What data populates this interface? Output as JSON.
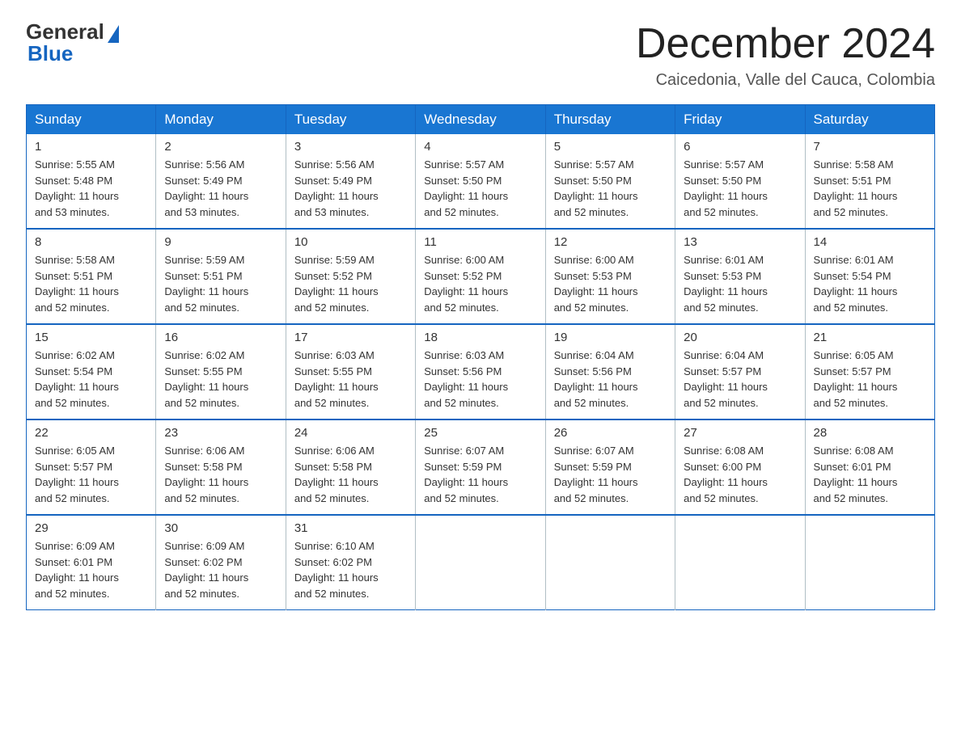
{
  "logo": {
    "general_text": "General",
    "blue_text": "Blue"
  },
  "header": {
    "month_year": "December 2024",
    "location": "Caicedonia, Valle del Cauca, Colombia"
  },
  "weekdays": [
    "Sunday",
    "Monday",
    "Tuesday",
    "Wednesday",
    "Thursday",
    "Friday",
    "Saturday"
  ],
  "weeks": [
    [
      {
        "day": "1",
        "sunrise": "5:55 AM",
        "sunset": "5:48 PM",
        "daylight": "11 hours and 53 minutes."
      },
      {
        "day": "2",
        "sunrise": "5:56 AM",
        "sunset": "5:49 PM",
        "daylight": "11 hours and 53 minutes."
      },
      {
        "day": "3",
        "sunrise": "5:56 AM",
        "sunset": "5:49 PM",
        "daylight": "11 hours and 53 minutes."
      },
      {
        "day": "4",
        "sunrise": "5:57 AM",
        "sunset": "5:50 PM",
        "daylight": "11 hours and 52 minutes."
      },
      {
        "day": "5",
        "sunrise": "5:57 AM",
        "sunset": "5:50 PM",
        "daylight": "11 hours and 52 minutes."
      },
      {
        "day": "6",
        "sunrise": "5:57 AM",
        "sunset": "5:50 PM",
        "daylight": "11 hours and 52 minutes."
      },
      {
        "day": "7",
        "sunrise": "5:58 AM",
        "sunset": "5:51 PM",
        "daylight": "11 hours and 52 minutes."
      }
    ],
    [
      {
        "day": "8",
        "sunrise": "5:58 AM",
        "sunset": "5:51 PM",
        "daylight": "11 hours and 52 minutes."
      },
      {
        "day": "9",
        "sunrise": "5:59 AM",
        "sunset": "5:51 PM",
        "daylight": "11 hours and 52 minutes."
      },
      {
        "day": "10",
        "sunrise": "5:59 AM",
        "sunset": "5:52 PM",
        "daylight": "11 hours and 52 minutes."
      },
      {
        "day": "11",
        "sunrise": "6:00 AM",
        "sunset": "5:52 PM",
        "daylight": "11 hours and 52 minutes."
      },
      {
        "day": "12",
        "sunrise": "6:00 AM",
        "sunset": "5:53 PM",
        "daylight": "11 hours and 52 minutes."
      },
      {
        "day": "13",
        "sunrise": "6:01 AM",
        "sunset": "5:53 PM",
        "daylight": "11 hours and 52 minutes."
      },
      {
        "day": "14",
        "sunrise": "6:01 AM",
        "sunset": "5:54 PM",
        "daylight": "11 hours and 52 minutes."
      }
    ],
    [
      {
        "day": "15",
        "sunrise": "6:02 AM",
        "sunset": "5:54 PM",
        "daylight": "11 hours and 52 minutes."
      },
      {
        "day": "16",
        "sunrise": "6:02 AM",
        "sunset": "5:55 PM",
        "daylight": "11 hours and 52 minutes."
      },
      {
        "day": "17",
        "sunrise": "6:03 AM",
        "sunset": "5:55 PM",
        "daylight": "11 hours and 52 minutes."
      },
      {
        "day": "18",
        "sunrise": "6:03 AM",
        "sunset": "5:56 PM",
        "daylight": "11 hours and 52 minutes."
      },
      {
        "day": "19",
        "sunrise": "6:04 AM",
        "sunset": "5:56 PM",
        "daylight": "11 hours and 52 minutes."
      },
      {
        "day": "20",
        "sunrise": "6:04 AM",
        "sunset": "5:57 PM",
        "daylight": "11 hours and 52 minutes."
      },
      {
        "day": "21",
        "sunrise": "6:05 AM",
        "sunset": "5:57 PM",
        "daylight": "11 hours and 52 minutes."
      }
    ],
    [
      {
        "day": "22",
        "sunrise": "6:05 AM",
        "sunset": "5:57 PM",
        "daylight": "11 hours and 52 minutes."
      },
      {
        "day": "23",
        "sunrise": "6:06 AM",
        "sunset": "5:58 PM",
        "daylight": "11 hours and 52 minutes."
      },
      {
        "day": "24",
        "sunrise": "6:06 AM",
        "sunset": "5:58 PM",
        "daylight": "11 hours and 52 minutes."
      },
      {
        "day": "25",
        "sunrise": "6:07 AM",
        "sunset": "5:59 PM",
        "daylight": "11 hours and 52 minutes."
      },
      {
        "day": "26",
        "sunrise": "6:07 AM",
        "sunset": "5:59 PM",
        "daylight": "11 hours and 52 minutes."
      },
      {
        "day": "27",
        "sunrise": "6:08 AM",
        "sunset": "6:00 PM",
        "daylight": "11 hours and 52 minutes."
      },
      {
        "day": "28",
        "sunrise": "6:08 AM",
        "sunset": "6:01 PM",
        "daylight": "11 hours and 52 minutes."
      }
    ],
    [
      {
        "day": "29",
        "sunrise": "6:09 AM",
        "sunset": "6:01 PM",
        "daylight": "11 hours and 52 minutes."
      },
      {
        "day": "30",
        "sunrise": "6:09 AM",
        "sunset": "6:02 PM",
        "daylight": "11 hours and 52 minutes."
      },
      {
        "day": "31",
        "sunrise": "6:10 AM",
        "sunset": "6:02 PM",
        "daylight": "11 hours and 52 minutes."
      },
      null,
      null,
      null,
      null
    ]
  ],
  "labels": {
    "sunrise": "Sunrise:",
    "sunset": "Sunset:",
    "daylight": "Daylight:"
  }
}
